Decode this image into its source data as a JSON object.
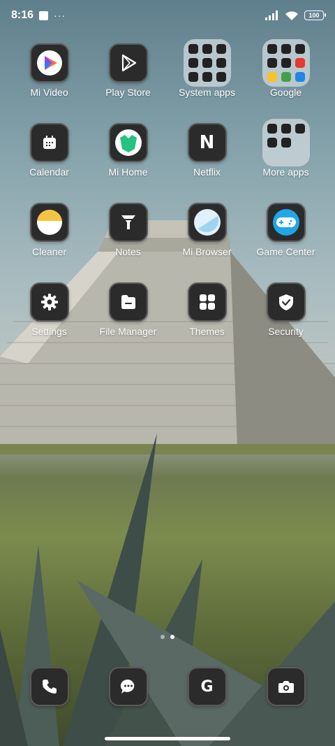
{
  "status_bar": {
    "time": "8:16",
    "battery": "100",
    "overflow": "···"
  },
  "apps": [
    {
      "label": "Mi Video",
      "icon": "mi-video-icon"
    },
    {
      "label": "Play Store",
      "icon": "play-store-icon"
    },
    {
      "label": "System apps",
      "icon": "folder-icon",
      "folder": true
    },
    {
      "label": "Google",
      "icon": "folder-icon",
      "folder": true
    },
    {
      "label": "Calendar",
      "icon": "calendar-icon"
    },
    {
      "label": "Mi Home",
      "icon": "mi-home-icon"
    },
    {
      "label": "Netflix",
      "icon": "netflix-icon"
    },
    {
      "label": "More apps",
      "icon": "folder-icon",
      "folder": true
    },
    {
      "label": "Cleaner",
      "icon": "cleaner-icon"
    },
    {
      "label": "Notes",
      "icon": "notes-icon"
    },
    {
      "label": "Mi Browser",
      "icon": "browser-icon"
    },
    {
      "label": "Game Center",
      "icon": "game-center-icon"
    },
    {
      "label": "Settings",
      "icon": "gear-icon"
    },
    {
      "label": "File Manager",
      "icon": "folder-file-icon"
    },
    {
      "label": "Themes",
      "icon": "themes-icon"
    },
    {
      "label": "Security",
      "icon": "shield-icon"
    }
  ],
  "dock": [
    {
      "icon": "phone-icon"
    },
    {
      "icon": "messages-icon"
    },
    {
      "icon": "google-icon",
      "text": "G"
    },
    {
      "icon": "camera-icon"
    }
  ],
  "netflix_letter": "N",
  "pages": {
    "count": 2,
    "current": 2
  },
  "colors": {
    "icon_bg": "#2b2b2b",
    "mi_video_accent": "#ff6a3d",
    "mi_home_green": "#25c281",
    "game_center_blue": "#1fa7e6",
    "cleaner_yellow": "#f5c542"
  }
}
